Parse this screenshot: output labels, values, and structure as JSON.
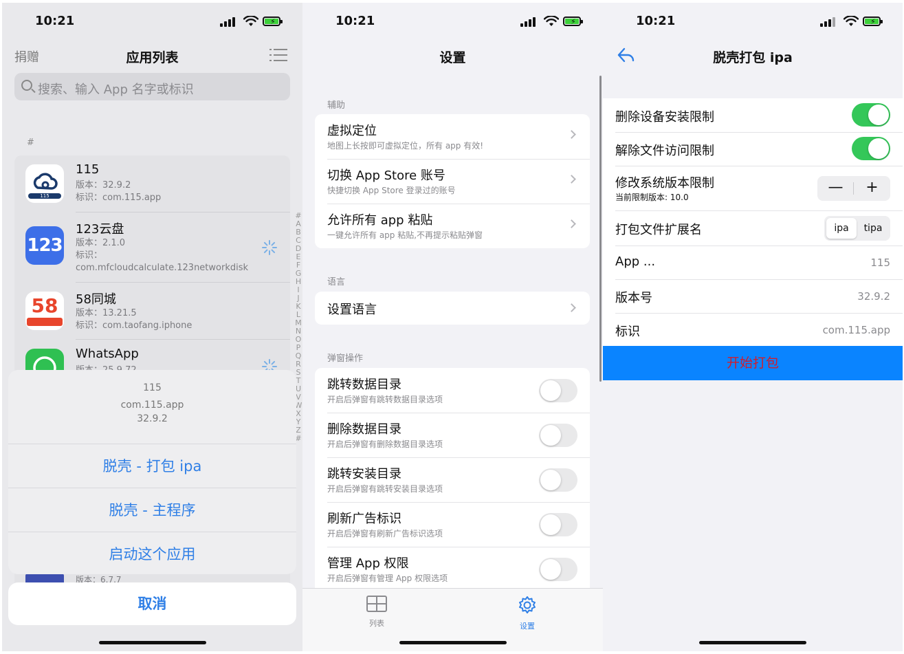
{
  "colors": {
    "accent": "#2f7fe6",
    "toggle_on": "#34c759",
    "start_button_bg": "#0a84ff",
    "start_button_text": "#d21c2a"
  },
  "status": {
    "time": "10:21"
  },
  "panel1": {
    "donate": "捐赠",
    "title": "应用列表",
    "search_placeholder": "搜索、输入 App 名字或标识",
    "section": "#",
    "apps": [
      {
        "name": "115",
        "version": "版本：32.9.2",
        "bundle": "标识：com.115.app",
        "icon": "cloud-icon",
        "icon_text": "115"
      },
      {
        "name": "123云盘",
        "version": "版本：2.1.0",
        "bundle_label": "标识：",
        "bundle": "com.mfcloudcalculate.123networkdisk",
        "icon": "123-icon",
        "icon_text": "123"
      },
      {
        "name": "58同城",
        "version": "版本：13.21.5",
        "bundle": "标识：com.taofang.iphone",
        "icon": "58-icon",
        "icon_text": "58"
      },
      {
        "name": "WhatsApp",
        "version": "版本：25.9.72",
        "icon": "whatsapp-icon"
      }
    ],
    "hidden_row_version": "版本：6.7.7",
    "index_letters": [
      "#",
      "A",
      "B",
      "C",
      "D",
      "E",
      "F",
      "G",
      "H",
      "I",
      "J",
      "K",
      "L",
      "M",
      "N",
      "O",
      "P",
      "Q",
      "R",
      "S",
      "T",
      "U",
      "V",
      "W",
      "X",
      "Y",
      "Z",
      "#"
    ],
    "sheet": {
      "app_name": "115",
      "bundle": "com.115.app",
      "version": "32.9.2",
      "actions": [
        "脱壳 - 打包 ipa",
        "脱壳 - 主程序",
        "启动这个应用"
      ],
      "cancel": "取消"
    }
  },
  "panel2": {
    "title": "设置",
    "groups": [
      {
        "label": "辅助",
        "cells": [
          {
            "title": "虚拟定位",
            "subtitle": "地图上长按即可虚拟定位，所有 app 有效!"
          },
          {
            "title": "切换 App Store 账号",
            "subtitle": "快捷切换 App Store 登录过的账号"
          },
          {
            "title": "允许所有 app 粘贴",
            "subtitle": "一键允许所有 app 粘贴,不再提示粘贴弹窗"
          }
        ]
      },
      {
        "label": "语言",
        "cells": [
          {
            "title": "设置语言"
          }
        ]
      },
      {
        "label": "弹窗操作",
        "cells": [
          {
            "title": "跳转数据目录",
            "subtitle": "开启后弹窗有跳转数据目录选项"
          },
          {
            "title": "删除数据目录",
            "subtitle": "开启后弹窗有删除数据目录选项"
          },
          {
            "title": "跳转安装目录",
            "subtitle": "开启后弹窗有跳转安装目录选项"
          },
          {
            "title": "刷新广告标识",
            "subtitle": "开启后弹窗有刷新广告标识选项"
          },
          {
            "title": "管理 App 权限",
            "subtitle": "开启后弹窗有管理 App 权限选项"
          }
        ]
      }
    ],
    "tabs": [
      {
        "label": "列表",
        "icon": "table-grid-icon"
      },
      {
        "label": "设置",
        "icon": "gear-icon"
      }
    ]
  },
  "panel3": {
    "title": "脱壳打包 ipa",
    "rows": {
      "remove_install_limit": "删除设备安装限制",
      "unlock_file_access": "解除文件访问限制",
      "os_version_limit": "修改系统版本限制",
      "os_version_current": "当前限制版本: 10.0",
      "stepper_minus": "—",
      "stepper_plus": "+",
      "extension_label": "打包文件扩展名",
      "extension_options": [
        "ipa",
        "tipa"
      ],
      "app_label": "App ...",
      "app_value": "115",
      "version_label": "版本号",
      "version_value": "32.9.2",
      "bundle_label": "标识",
      "bundle_value": "com.115.app"
    },
    "start_button": "开始打包"
  }
}
